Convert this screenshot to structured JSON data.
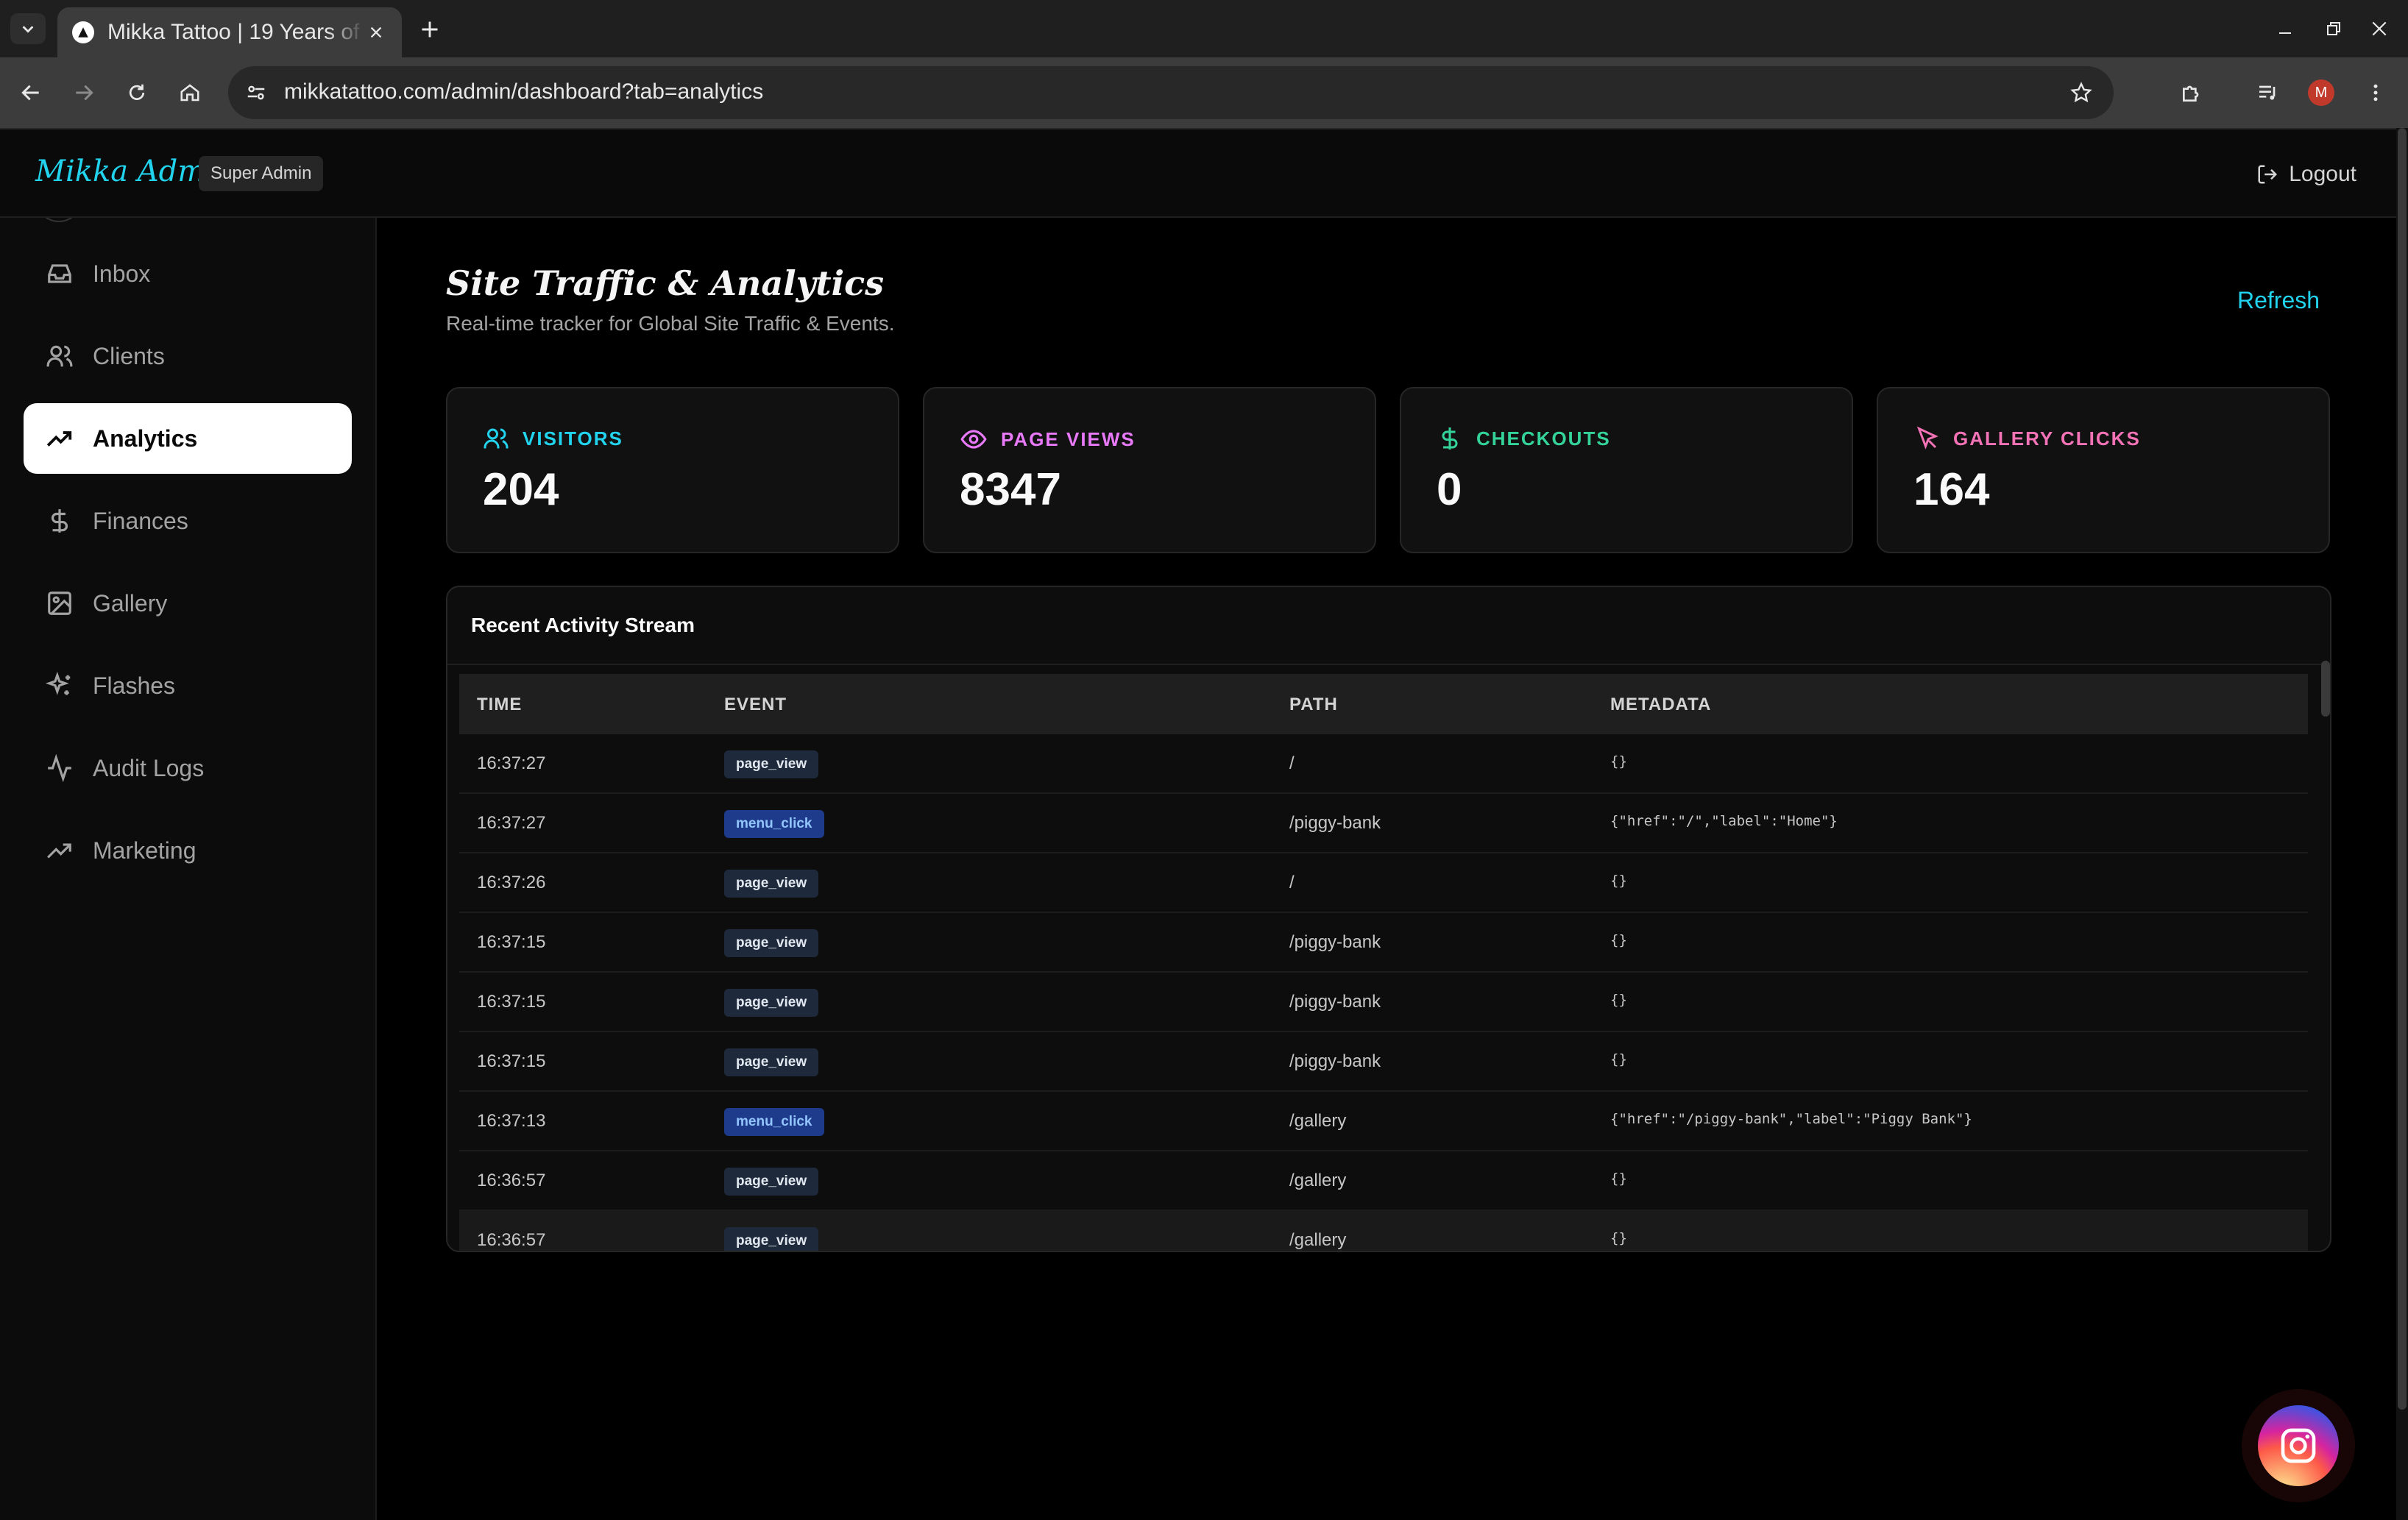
{
  "browser": {
    "tab_title": "Mikka Tattoo | 19 Years of",
    "url": "mikkatattoo.com/admin/dashboard?tab=analytics",
    "profile_initial": "M"
  },
  "header": {
    "brand": "Mikka Admin",
    "role": "Super Admin",
    "logout_label": "Logout"
  },
  "sidebar": {
    "items": [
      {
        "label": "Inbox",
        "icon": "inbox-icon",
        "active": false
      },
      {
        "label": "Clients",
        "icon": "users-icon",
        "active": false
      },
      {
        "label": "Analytics",
        "icon": "trending-up-icon",
        "active": true
      },
      {
        "label": "Finances",
        "icon": "dollar-icon",
        "active": false
      },
      {
        "label": "Gallery",
        "icon": "image-icon",
        "active": false
      },
      {
        "label": "Flashes",
        "icon": "sparkles-icon",
        "active": false
      },
      {
        "label": "Audit Logs",
        "icon": "activity-icon",
        "active": false
      },
      {
        "label": "Marketing",
        "icon": "trending-up-icon",
        "active": false
      }
    ]
  },
  "main": {
    "title": "Site Traffic & Analytics",
    "subtitle": "Real-time tracker for Global Site Traffic & Events.",
    "refresh_label": "Refresh",
    "stats": [
      {
        "label": "VISITORS",
        "value": "204",
        "color": "#22d3ee",
        "icon": "users-icon"
      },
      {
        "label": "PAGE VIEWS",
        "value": "8347",
        "color": "#e879f9",
        "icon": "eye-icon"
      },
      {
        "label": "CHECKOUTS",
        "value": "0",
        "color": "#34d399",
        "icon": "dollar-icon"
      },
      {
        "label": "GALLERY CLICKS",
        "value": "164",
        "color": "#f472b6",
        "icon": "cursor-click-icon"
      }
    ],
    "activity": {
      "title": "Recent Activity Stream",
      "columns": {
        "time": "TIME",
        "event": "EVENT",
        "path": "PATH",
        "metadata": "METADATA"
      },
      "rows": [
        {
          "time": "16:37:27",
          "event": "page_view",
          "path": "/",
          "metadata": "{}"
        },
        {
          "time": "16:37:27",
          "event": "menu_click",
          "path": "/piggy-bank",
          "metadata": "{\"href\":\"/\",\"label\":\"Home\"}"
        },
        {
          "time": "16:37:26",
          "event": "page_view",
          "path": "/",
          "metadata": "{}"
        },
        {
          "time": "16:37:15",
          "event": "page_view",
          "path": "/piggy-bank",
          "metadata": "{}"
        },
        {
          "time": "16:37:15",
          "event": "page_view",
          "path": "/piggy-bank",
          "metadata": "{}"
        },
        {
          "time": "16:37:15",
          "event": "page_view",
          "path": "/piggy-bank",
          "metadata": "{}"
        },
        {
          "time": "16:37:13",
          "event": "menu_click",
          "path": "/gallery",
          "metadata": "{\"href\":\"/piggy-bank\",\"label\":\"Piggy Bank\"}"
        },
        {
          "time": "16:36:57",
          "event": "page_view",
          "path": "/gallery",
          "metadata": "{}"
        },
        {
          "time": "16:36:57",
          "event": "page_view",
          "path": "/gallery",
          "metadata": "{}"
        }
      ]
    }
  },
  "colors": {
    "accent": "#22d3ee",
    "active_nav_bg": "#ffffff",
    "instagram_fab": "#e1306c"
  }
}
